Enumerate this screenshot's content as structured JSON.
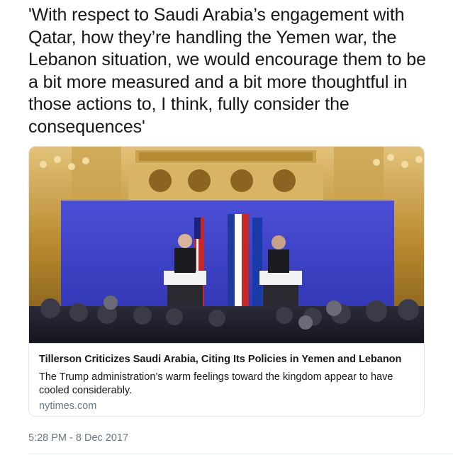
{
  "tweet": {
    "text": "'With respect to Saudi Arabia’s engagement with Qatar, how they’re handling the Yemen war, the Lebanon situation, we would encourage them to be a bit more measured and a bit more thoughtful in those actions to, I think, fully consider the consequences'",
    "timestamp": "5:28 PM - 8 Dec 2017"
  },
  "card": {
    "title": "Tillerson Criticizes Saudi Arabia, Citing Its Policies in Yemen and Lebanon",
    "description": "The Trump administration’s warm feelings toward the kingdom appear to have cooled considerably.",
    "domain": "nytimes.com",
    "image_icon": "press-conference-photo"
  },
  "colors": {
    "text": "#14171a",
    "secondary": "#657786",
    "border": "#e1e8ed",
    "backdrop_blue": "#3a3fc4",
    "gold": "#b8892e"
  }
}
